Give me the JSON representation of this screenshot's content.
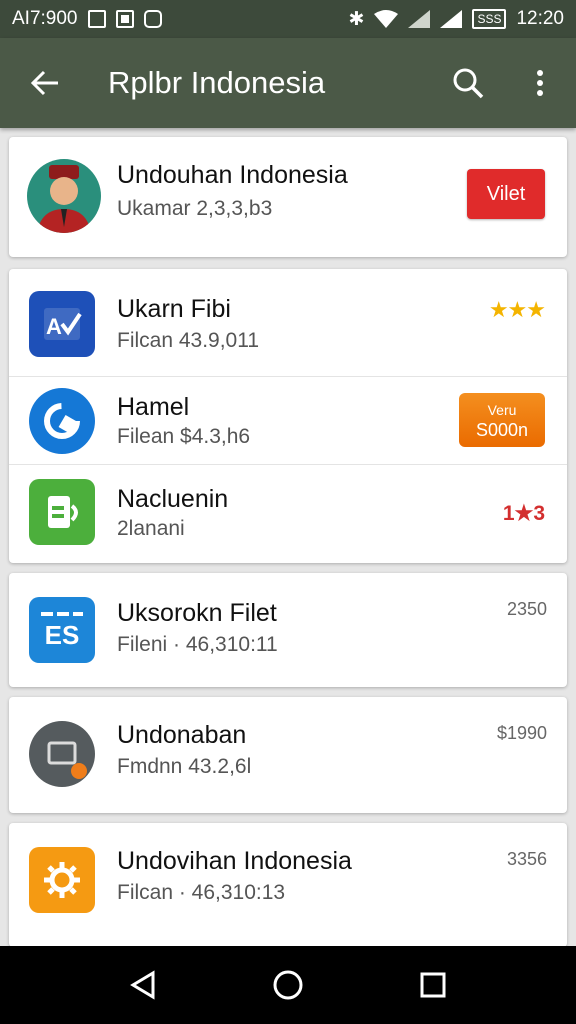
{
  "status_bar": {
    "left_text": "AI7:900",
    "time": "12:20",
    "battery_text": "SSS"
  },
  "app_bar": {
    "title": "Rplbr Indonesia"
  },
  "featured": {
    "title": "Undouhan Indonesia",
    "subtitle": "Ukamar 2,3,3,b3",
    "button_label": "Vilet",
    "button_color": "#e02b2b"
  },
  "group1": [
    {
      "title": "Ukarn Fibi",
      "subtitle": "Filcan 43.9,011",
      "icon": "word-doc-icon",
      "icon_color": "#1e50b8",
      "badge": "★★★"
    },
    {
      "title": "Hamel",
      "subtitle": "Filean $4.3,h6",
      "icon": "refresh-app-icon",
      "icon_color": "#1578d6",
      "button_top": "Veru",
      "button_bottom": "S000n"
    },
    {
      "title": "Nacluenin",
      "subtitle": "2lanani",
      "icon": "sheet-app-icon",
      "icon_color": "#4caf3c",
      "rating": "1★3"
    }
  ],
  "item_es": {
    "title": "Uksorokn Filet",
    "subtitle": "Fileni · 46,310:11",
    "icon_text": "ES",
    "icon": "es-file-icon",
    "icon_color": "#1d86d8",
    "right": "2350"
  },
  "item_und1": {
    "title": "Undonaban",
    "subtitle": "Fmdnn 43.2,6l",
    "icon": "folder-app-icon",
    "icon_color": "#555b5e",
    "right": "$1990"
  },
  "item_und2": {
    "title": "Undovihan Indonesia",
    "subtitle": "Filcan · 46,310:13",
    "icon": "gear-app-icon",
    "icon_color": "#f59a12",
    "right": "3356"
  }
}
